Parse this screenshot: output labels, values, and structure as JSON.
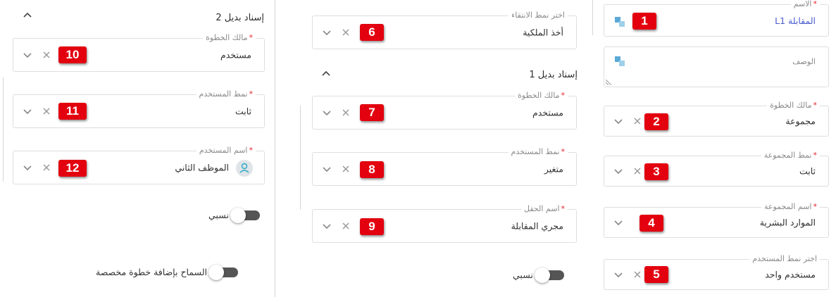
{
  "right_panel": {
    "name_field": {
      "label": "الاسم",
      "value": "المقابلة L1"
    },
    "description_field": {
      "placeholder": "الوصف"
    },
    "step_owner": {
      "label": "مالك الخطوة",
      "value": "مجموعة"
    },
    "group_type": {
      "label": "نمط المجموعة",
      "value": "ثابت"
    },
    "group_name": {
      "label": "اسم المجموعة",
      "value": "الموارد البشرية"
    },
    "user_type_select": {
      "label": "اختر نمط المستخدم",
      "value": "مستخدم واحد"
    }
  },
  "middle_panel": {
    "selection_type": {
      "label": "اختر نمط الانتقاء",
      "value": "أخذ الملكية"
    },
    "alt1": {
      "title": "إسناد بديل 1",
      "step_owner": {
        "label": "مالك الخطوة",
        "value": "مستخدم"
      },
      "user_type": {
        "label": "نمط المستخدم",
        "value": "متغير"
      },
      "field_name": {
        "label": "اسم الحقل",
        "value": "مجري المقابلة"
      }
    },
    "relative_toggle": {
      "label": "نسبي",
      "on": false
    }
  },
  "left_panel": {
    "alt2": {
      "title": "إسناد بديل 2",
      "step_owner": {
        "label": "مالك الخطوة",
        "value": "مستخدم"
      },
      "user_type": {
        "label": "نمط المستخدم",
        "value": "ثابت"
      },
      "user_name": {
        "label": "اسم المستخدم",
        "value": "الموظف الثاني"
      }
    },
    "relative_toggle": {
      "label": "نسبي",
      "on": false
    },
    "custom_step_toggle": {
      "label": "السماح بإضافة خطوة مخصصة",
      "on": false
    }
  },
  "markers": [
    "1",
    "2",
    "3",
    "4",
    "5",
    "6",
    "7",
    "8",
    "9",
    "10",
    "11",
    "12"
  ],
  "required_mark": "*",
  "colors": {
    "marker": "#e3000f",
    "accent_link": "#4a5bd0",
    "toggle_track": "#555555",
    "border": "#dedede"
  }
}
